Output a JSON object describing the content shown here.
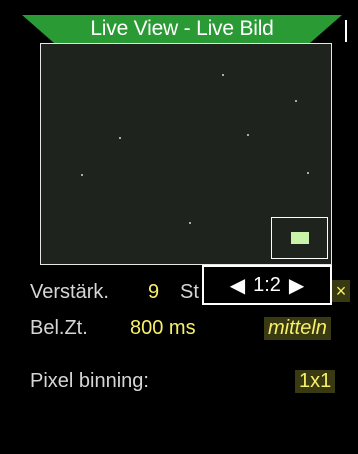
{
  "title": "Live View - Live Bild",
  "view": {
    "stars": 7
  },
  "zoom": {
    "left_arrow": "◀",
    "ratio": "1:2",
    "right_arrow": "▶"
  },
  "gain": {
    "label": "Verstärk.",
    "value": "9",
    "partial_label": "St",
    "hidden_mark": "×"
  },
  "exposure": {
    "label": "Bel.Zt.",
    "value": "800 ms",
    "mode": "mitteln"
  },
  "binning": {
    "label": "Pixel binning:",
    "value": "1x1"
  },
  "colors": {
    "title_green": "#2a9a35",
    "value_yellow": "#f6f06a",
    "chip_bg": "#3a3a12"
  }
}
